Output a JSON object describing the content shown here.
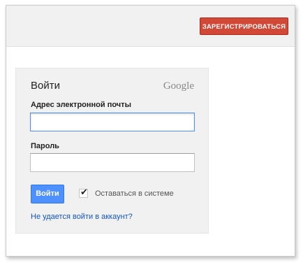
{
  "header": {
    "signup_label": "ЗАРЕГИСТРИРОВАТЬСЯ"
  },
  "login": {
    "title": "Войти",
    "logo_text": "Google",
    "email_label": "Адрес электронной почты",
    "email_value": "",
    "password_label": "Пароль",
    "password_value": "",
    "signin_label": "Войти",
    "remember_checked": true,
    "remember_label": "Оставаться в системе",
    "trouble_link": "Не удается войти в аккаунт?"
  },
  "colors": {
    "signup_button": "#d14836",
    "signin_button": "#4d90fe",
    "link": "#1155cc",
    "focus_border": "#4d90fe"
  },
  "icons": {
    "checkbox": "checkmark-icon"
  }
}
